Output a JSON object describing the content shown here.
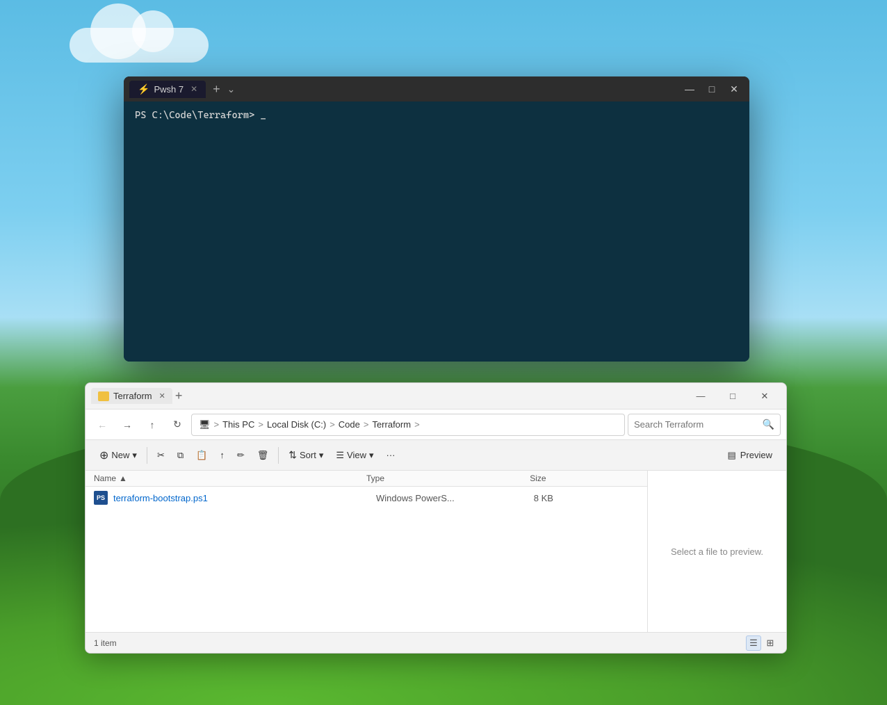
{
  "desktop": {
    "background_desc": "Windows XP bliss style landscape"
  },
  "terminal": {
    "title": "Pwsh 7",
    "tab_label": "Pwsh 7",
    "prompt": "PS C:\\Code\\Terraform> _",
    "add_tab_label": "+",
    "dropdown_label": "⌄",
    "minimize_label": "—",
    "maximize_label": "□",
    "close_label": "✕"
  },
  "explorer": {
    "title": "Terraform",
    "tab_label": "Terraform",
    "add_tab_label": "+",
    "minimize_label": "—",
    "maximize_label": "□",
    "close_label": "✕",
    "breadcrumb": {
      "this_pc": "This PC",
      "local_disk": "Local Disk (C:)",
      "code": "Code",
      "terraform": "Terraform",
      "more": "›"
    },
    "search_placeholder": "Search Terraform",
    "toolbar": {
      "new_label": "New",
      "cut_icon": "✂",
      "copy_icon": "⧉",
      "paste_icon": "📋",
      "share_icon": "⤴",
      "rename_icon": "✏",
      "delete_icon": "🗑",
      "sort_label": "Sort",
      "view_label": "View",
      "more_label": "···",
      "preview_label": "Preview"
    },
    "columns": {
      "name": "Name",
      "type": "Type",
      "size": "Size"
    },
    "files": [
      {
        "name": "terraform-bootstrap.ps1",
        "type": "Windows PowerS...",
        "size": "8 KB",
        "icon_type": "ps1"
      }
    ],
    "preview_hint": "Select a file to preview.",
    "status": {
      "item_count": "1 item"
    },
    "view_buttons": {
      "list": "☰",
      "details": "⊞"
    }
  }
}
